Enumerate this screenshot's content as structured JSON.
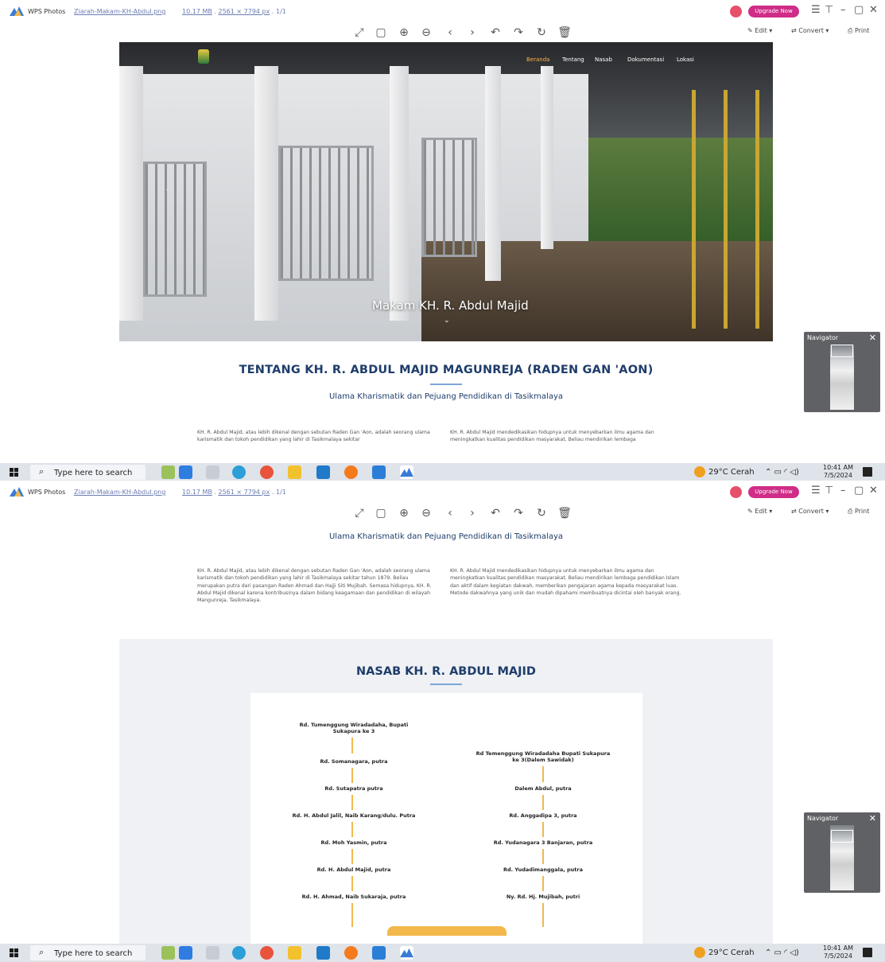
{
  "app": {
    "name": "WPS Photos",
    "file_name": "Ziarah-Makam-KH-Abdul.png",
    "file_size": "10.17 MB",
    "dimensions": "2561 × 7794 px",
    "page_count": "1/1",
    "upgrade_label": "Upgrade Now",
    "edit_label": "Edit",
    "convert_label": "Convert",
    "print_label": "Print"
  },
  "site": {
    "nav": [
      "Beranda",
      "Tentang",
      "Nasab",
      "Dokumentasi",
      "Lokasi"
    ],
    "hero_title": "Makam KH. R. Abdul Majid",
    "about_title": "TENTANG KH. R. ABDUL MAJID MAGUNREJA (RADEN GAN 'AON)",
    "about_subtitle": "Ulama Kharismatik dan Pejuang Pendidikan di Tasikmalaya",
    "para_left": "KH. R. Abdul Majid, atau lebih dikenal dengan sebutan Raden Gan 'Aon, adalah seorang ulama karismatik dan tokoh pendidikan yang lahir di Tasikmalaya sekitar tahun 1879. Beliau merupakan putra dari pasangan Raden Ahmad dan Hajji Siti Mujibah. Semasa hidupnya, KH. R. Abdul Majid dikenal karena kontribusinya dalam bidang keagamaan dan pendidikan di wilayah Mangunreja, Tasikmalaya.",
    "para_right": "KH. R. Abdul Majid mendedikasikan hidupnya untuk menyebarkan ilmu agama dan meningkatkan kualitas pendidikan masyarakat. Beliau mendirikan lembaga pendidikan Islam dan aktif dalam kegiatan dakwah, memberikan pengajaran agama kepada masyarakat luas. Metode dakwahnya yang unik dan mudah dipahami membuatnya dicintai oleh banyak orang.",
    "para_left_cut": "KH. R. Abdul Majid, atau lebih dikenal dengan sebutan Raden Gan 'Aon, adalah seorang ulama karismatik dan tokoh pendidikan yang lahir di Tasikmalaya sekitar",
    "para_right_cut": "KH. R. Abdul Majid mendedikasikan hidupnya untuk menyebarkan ilmu agama dan meningkatkan kualitas pendidikan masyarakat. Beliau mendirikan lembaga",
    "nasab_title": "NASAB KH. R. ABDUL MAJID",
    "tree_left": [
      "Rd. Tumenggung Wiradadaha, Bupati Sukapura ke 3",
      "Rd. Somanagara, putra",
      "Rd. Sutapatra putra",
      "Rd. H. Abdul Jalil, Naib Karang/dulu. Putra",
      "Rd. Moh Yasmin, putra",
      "Rd. H. Abdul Majid, putra",
      "Rd. H. Ahmad, Naib Sukaraja, putra"
    ],
    "tree_right": [
      "Rd  Temenggung Wiradadaha Bupati Sukapura ke 3(Dalem Sawidak)",
      "Dalem Abdul, putra",
      "Rd. Anggadipa 3, putra",
      "Rd. Yudanagara 3 Banjaran, putra",
      "Rd. Yudadimanggala, putra",
      "Ny. Rd. Hj. Mujibah, putri"
    ]
  },
  "navigator": {
    "title": "Navigator"
  },
  "taskbar": {
    "search_placeholder": "Type here to search",
    "weather": "29°C  Cerah",
    "time": "10:41 AM",
    "date": "7/5/2024"
  }
}
